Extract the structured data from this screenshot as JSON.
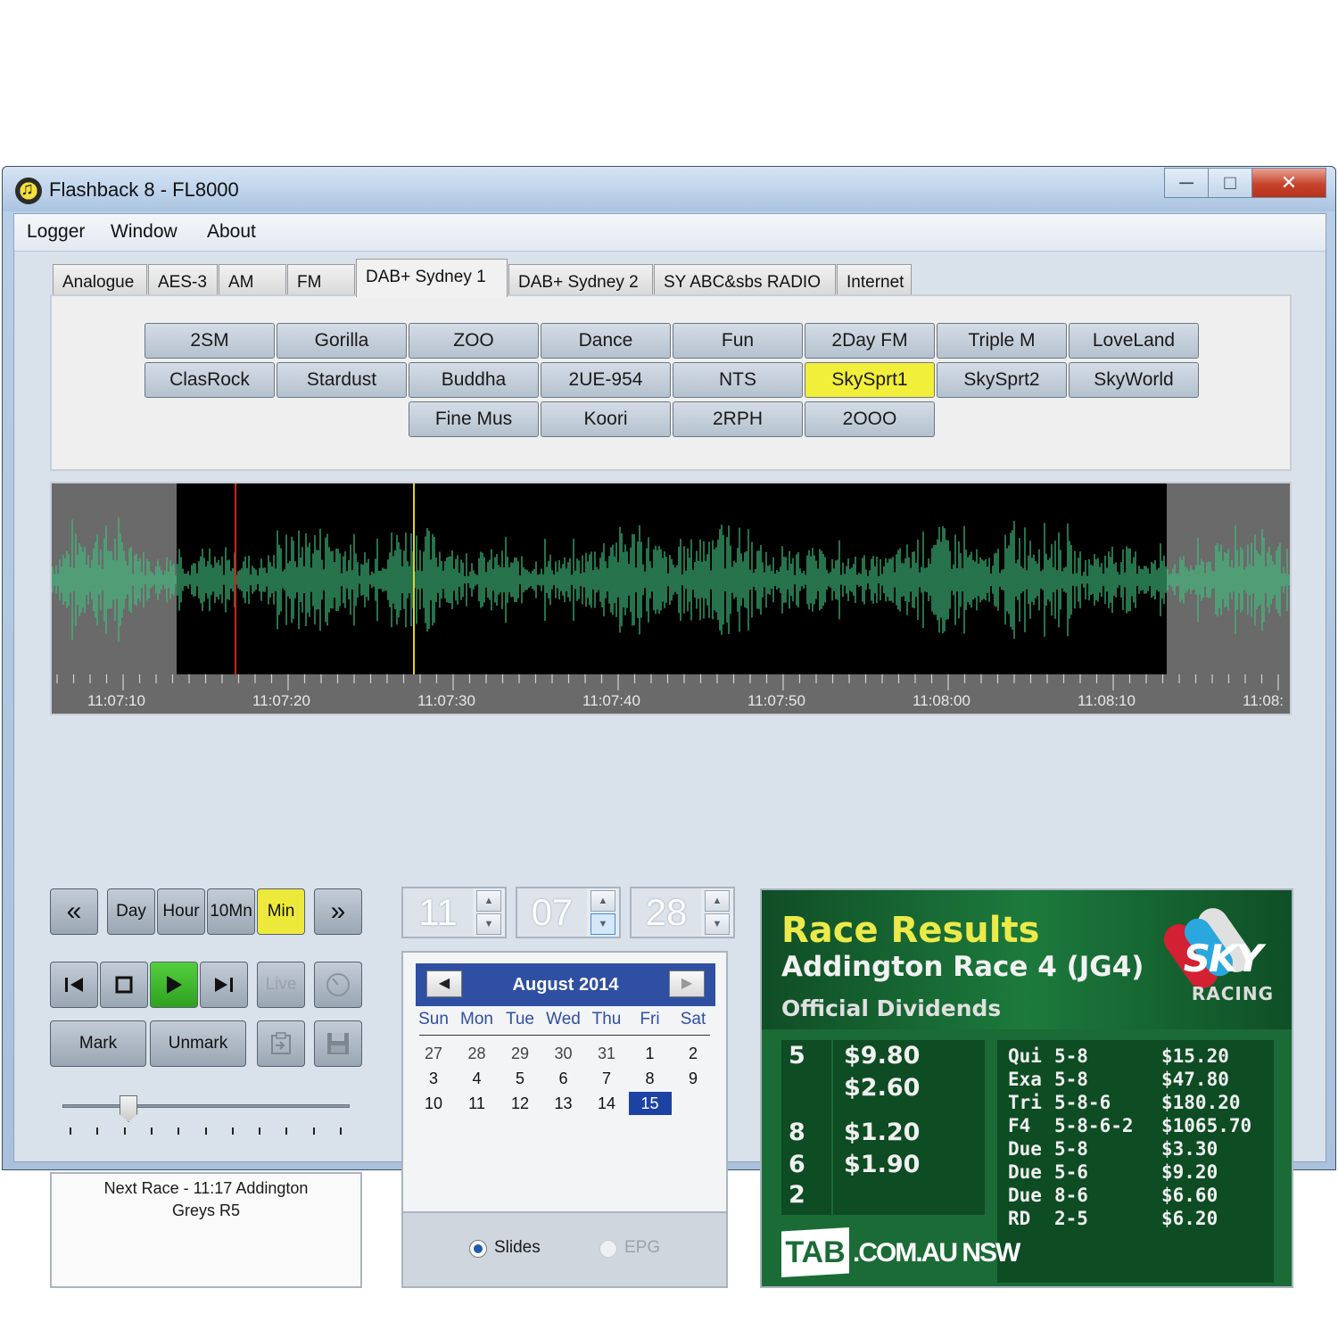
{
  "window": {
    "title": "Flashback 8 - FL8000"
  },
  "menu": [
    "Logger",
    "Window",
    "About"
  ],
  "tabs": [
    "Analogue",
    "AES-3",
    "AM",
    "FM",
    "DAB+ Sydney 1",
    "DAB+ Sydney 2",
    "SY ABC&sbs RADIO",
    "Internet"
  ],
  "active_tab": "DAB+ Sydney 1",
  "stations": {
    "row1": [
      "2SM",
      "Gorilla",
      "ZOO",
      "Dance",
      "Fun",
      "2Day FM",
      "Triple M",
      "LoveLand"
    ],
    "row2": [
      "ClasRock",
      "Stardust",
      "Buddha",
      "2UE-954",
      "NTS",
      "SkySprt1",
      "SkySprt2",
      "SkyWorld"
    ],
    "row3": [
      "Fine Mus",
      "Koori",
      "2RPH",
      "2OOO"
    ],
    "selected": "SkySprt1"
  },
  "waveform": {
    "ticks": [
      "11:07:10",
      "11:07:20",
      "11:07:30",
      "11:07:40",
      "11:07:50",
      "11:08:00",
      "11:08:10",
      "11:08:"
    ],
    "colors": {
      "wave": "#3fbf7f",
      "playhead": "#e3d12a",
      "marker": "#d42020",
      "bg": "#000000",
      "outside": "#6a6a6a"
    }
  },
  "transport": {
    "rewind_label": "«",
    "day": "Day",
    "hour": "Hour",
    "ten_min": "10Mn",
    "min": "Min",
    "forward_label": "»",
    "live": "Live",
    "mark": "Mark",
    "unmark": "Unmark"
  },
  "slider": {
    "value": 0.23
  },
  "next_race": {
    "line1": "Next Race - 11:17 Addington",
    "line2": "Greys R5"
  },
  "time": {
    "hour": "11",
    "minute": "07",
    "second": "28"
  },
  "calendar": {
    "title": "August 2014",
    "prev": "◀",
    "next": "▶",
    "dow": [
      "Sun",
      "Mon",
      "Tue",
      "Wed",
      "Thu",
      "Fri",
      "Sat"
    ],
    "weeks": [
      [
        "27",
        "28",
        "29",
        "30",
        "31",
        "1",
        "2"
      ],
      [
        "3",
        "4",
        "5",
        "6",
        "7",
        "8",
        "9"
      ],
      [
        "10",
        "11",
        "12",
        "13",
        "14",
        "15",
        ""
      ]
    ],
    "selected": "15"
  },
  "mode": {
    "slides": "Slides",
    "epg": "EPG",
    "selected": "Slides"
  },
  "slide": {
    "title": "Race Results",
    "race": "Addington Race 4 (JG4)",
    "subtitle": "Official Dividends",
    "logo_sky": "SKY",
    "logo_racing": "RACING",
    "win_place": [
      {
        "runner": "5",
        "amount": "$9.80"
      },
      {
        "runner": "",
        "amount": "$2.60"
      },
      {
        "runner": "8",
        "amount": "$1.20"
      },
      {
        "runner": "6",
        "amount": "$1.90"
      },
      {
        "runner": "2",
        "amount": ""
      }
    ],
    "exotics": [
      {
        "type": "Qui",
        "combo": "5-8",
        "amount": "$15.20"
      },
      {
        "type": "Exa",
        "combo": "5-8",
        "amount": "$47.80"
      },
      {
        "type": "Tri",
        "combo": "5-8-6",
        "amount": "$180.20"
      },
      {
        "type": "F4",
        "combo": "5-8-6-2",
        "amount": "$1065.70"
      },
      {
        "type": "Due",
        "combo": "5-8",
        "amount": "$3.30"
      },
      {
        "type": "Due",
        "combo": "5-6",
        "amount": "$9.20"
      },
      {
        "type": "Due",
        "combo": "8-6",
        "amount": "$6.60"
      },
      {
        "type": "RD",
        "combo": "2-5",
        "amount": "$6.20"
      }
    ],
    "tab_logo": "TAB",
    "tab_rest": ".COM.AU  NSW"
  }
}
